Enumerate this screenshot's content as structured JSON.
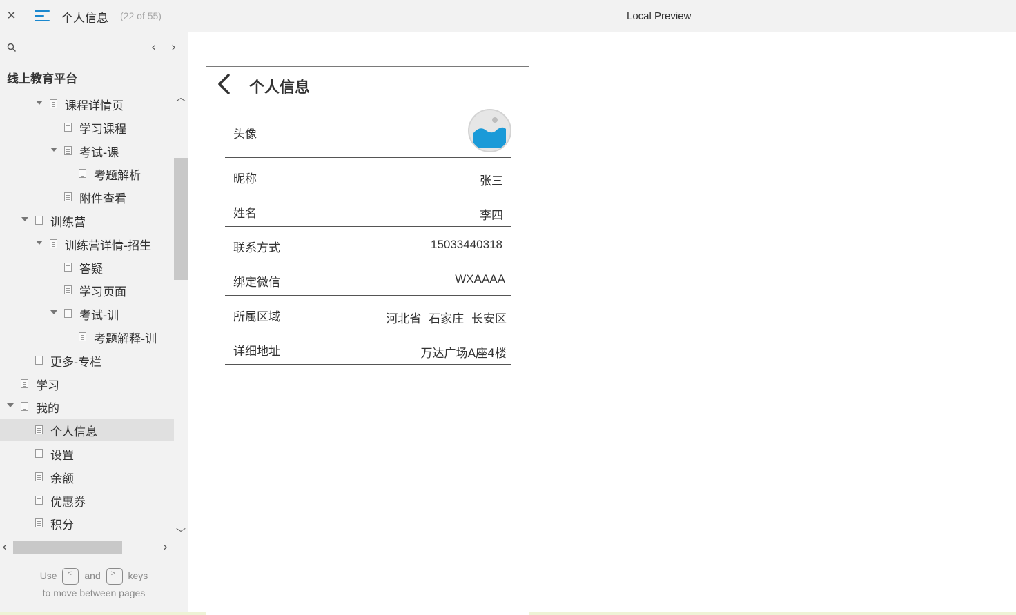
{
  "topbar": {
    "page_title": "个人信息",
    "page_count": "(22 of 55)",
    "preview_label": "Local Preview"
  },
  "sidebar": {
    "project_title": "线上教育平台",
    "tree": [
      {
        "label": "课程详情页",
        "depth": 3,
        "expanded": true
      },
      {
        "label": "学习课程",
        "depth": 4,
        "expanded": null
      },
      {
        "label": "考试-课",
        "depth": 4,
        "expanded": true
      },
      {
        "label": "考题解析",
        "depth": 5,
        "expanded": null
      },
      {
        "label": "附件查看",
        "depth": 4,
        "expanded": null
      },
      {
        "label": "训练营",
        "depth": 2,
        "expanded": true
      },
      {
        "label": "训练营详情-招生",
        "depth": 3,
        "expanded": true
      },
      {
        "label": "答疑",
        "depth": 4,
        "expanded": null
      },
      {
        "label": "学习页面",
        "depth": 4,
        "expanded": null
      },
      {
        "label": "考试-训",
        "depth": 4,
        "expanded": true
      },
      {
        "label": "考题解释-训",
        "depth": 5,
        "expanded": null
      },
      {
        "label": "更多-专栏",
        "depth": 2,
        "expanded": null
      },
      {
        "label": "学习",
        "depth": 1,
        "expanded": null
      },
      {
        "label": "我的",
        "depth": 1,
        "expanded": true
      },
      {
        "label": "个人信息",
        "depth": 2,
        "expanded": null,
        "selected": true
      },
      {
        "label": "设置",
        "depth": 2,
        "expanded": null
      },
      {
        "label": "余额",
        "depth": 2,
        "expanded": null
      },
      {
        "label": "优惠券",
        "depth": 2,
        "expanded": null
      },
      {
        "label": "积分",
        "depth": 2,
        "expanded": null
      }
    ],
    "hint": {
      "use": "Use",
      "prev_key": "<",
      "and": "and",
      "next_key": ">",
      "keys": "keys",
      "line2": "to move between pages"
    }
  },
  "phone": {
    "nav_title": "个人信息",
    "avatar_label": "头像",
    "rows": [
      {
        "label": "昵称",
        "value": "张三"
      },
      {
        "label": "姓名",
        "value": "李四"
      },
      {
        "label": "联系方式",
        "value": "15033440318"
      },
      {
        "label": "绑定微信",
        "value": "WXAAAA"
      },
      {
        "label": "所属区域",
        "value": "河北省  石家庄  长安区"
      },
      {
        "label": "详细地址",
        "value": "万达广场A座4楼"
      }
    ]
  },
  "colors": {
    "accent": "#1a88cf",
    "avatar_image": "#1a9ad8",
    "selected_row": "#e0e0e0",
    "sidebar_bg": "#f2f2f2"
  }
}
